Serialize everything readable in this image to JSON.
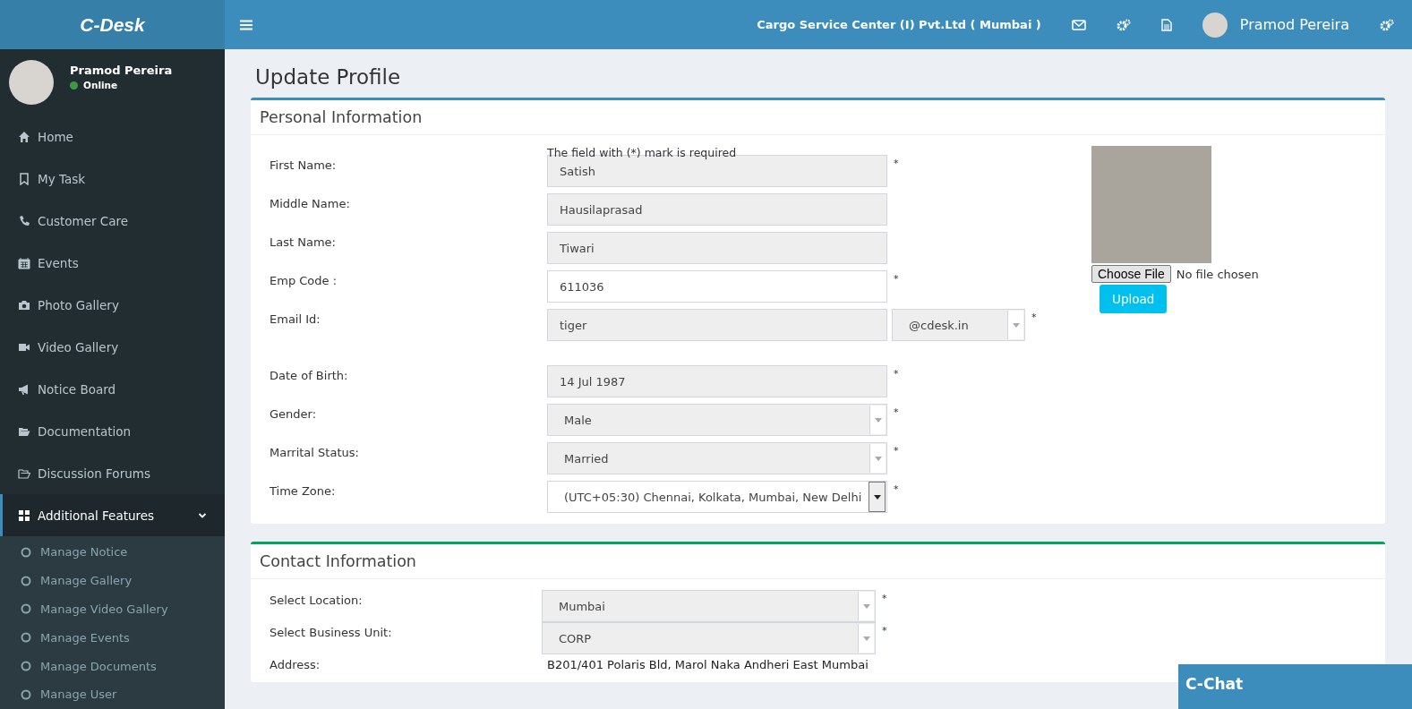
{
  "brand": "C-Desk",
  "header": {
    "company": "Cargo Service Center (I) Pvt.Ltd ( Mumbai )",
    "user_name": "Pramod Pereira"
  },
  "sidebar": {
    "user": {
      "name": "Pramod Pereira",
      "status": "Online",
      "online": true
    },
    "items": [
      {
        "label": "Home",
        "selected": false
      },
      {
        "label": "My Task",
        "selected": false
      },
      {
        "label": "Customer Care",
        "selected": false
      },
      {
        "label": "Events",
        "selected": false
      },
      {
        "label": "Photo Gallery",
        "selected": false
      },
      {
        "label": "Video Gallery",
        "selected": false
      },
      {
        "label": "Notice Board",
        "selected": false
      },
      {
        "label": "Documentation",
        "selected": false
      },
      {
        "label": "Discussion Forums",
        "selected": false
      },
      {
        "label": "Additional Features",
        "selected": true,
        "expanded": true,
        "children": [
          {
            "label": "Manage Notice",
            "selected": false
          },
          {
            "label": "Manage Gallery",
            "selected": false
          },
          {
            "label": "Manage Video Gallery",
            "selected": false
          },
          {
            "label": "Manage Events",
            "selected": false
          },
          {
            "label": "Manage Documents",
            "selected": false
          },
          {
            "label": "Manage User",
            "selected": false
          }
        ]
      }
    ]
  },
  "page_title": "Update Profile",
  "personal": {
    "title": "Personal Information",
    "note": "The field  with (*) mark is required",
    "fields": [
      {
        "label": "First Name:",
        "kind": "text",
        "value": "Satish",
        "disabled": true,
        "mark": "*"
      },
      {
        "label": "Middle Name:",
        "kind": "text",
        "value": "Hausilaprasad",
        "disabled": true
      },
      {
        "label": "Last Name:",
        "kind": "text",
        "value": "Tiwari",
        "disabled": true
      },
      {
        "label": "Emp Code :",
        "kind": "text",
        "value": "611036",
        "disabled": false,
        "mark": "*"
      },
      {
        "label": "Email Id:",
        "kind": "email",
        "value": "tiger",
        "domain": "@cdesk.in",
        "disabled": true,
        "mark": "*"
      },
      {
        "label": "Date of Birth:",
        "kind": "text",
        "value": "14 Jul 1987",
        "disabled": true,
        "mark": "*"
      },
      {
        "label": "Gender:",
        "kind": "select",
        "value": "Male",
        "disabled": true,
        "mark": "*"
      },
      {
        "label": "Marrital Status:",
        "kind": "select",
        "value": "Married",
        "disabled": true,
        "mark": "*"
      },
      {
        "label": "Time Zone:",
        "kind": "select",
        "value": "(UTC+05:30) Chennai, Kolkata, Mumbai, New Delhi",
        "disabled": false,
        "mark": "*"
      }
    ],
    "photo": {
      "choose_label": "Choose File",
      "file_status": "No file chosen",
      "upload_label": "Upload"
    }
  },
  "contact": {
    "title": "Contact Information",
    "fields": [
      {
        "label": "Select Location:",
        "kind": "select",
        "value": "Mumbai",
        "disabled": true,
        "mark": "*"
      },
      {
        "label": "Select Business Unit:",
        "kind": "select",
        "value": "CORP",
        "disabled": true,
        "mark": "*"
      },
      {
        "label": "Address:",
        "kind": "static",
        "value": "B201/401 Polaris Bld, Marol Naka Andheri East Mumbai"
      }
    ]
  },
  "chat": {
    "title": "C-Chat"
  }
}
